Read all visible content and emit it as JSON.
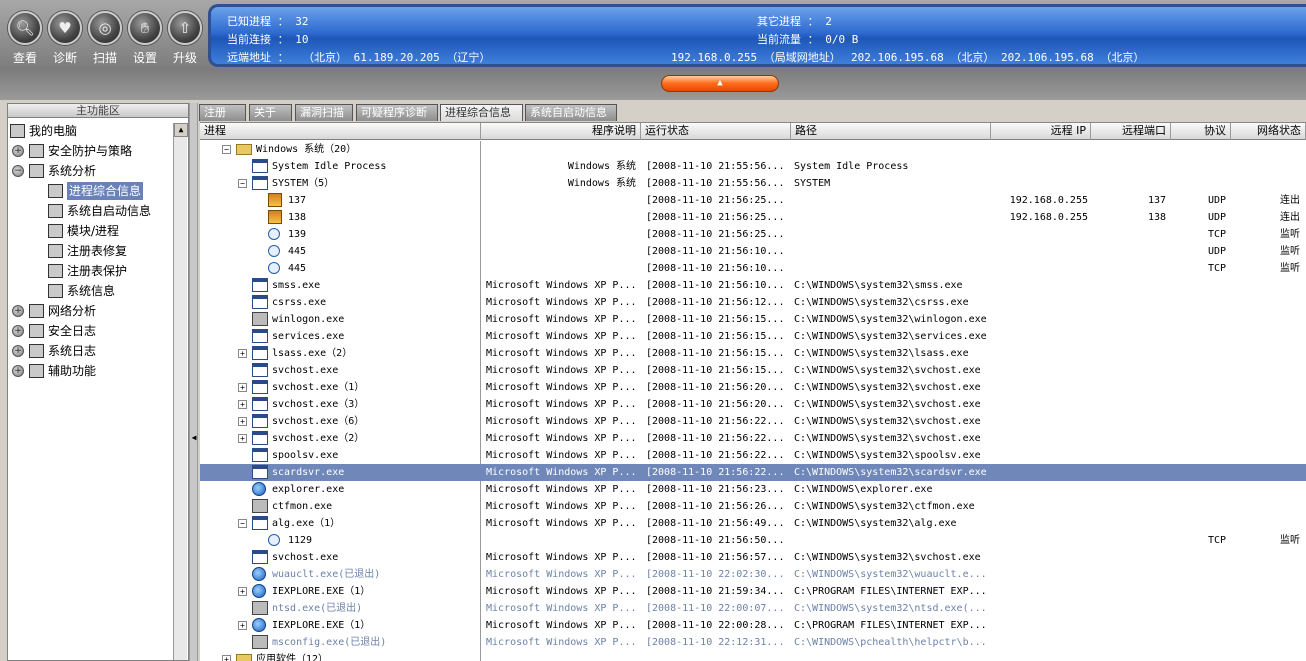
{
  "toolbar": {
    "buttons": [
      {
        "label": "查看",
        "icon": "magnifier-icon"
      },
      {
        "label": "诊断",
        "icon": "heart-icon"
      },
      {
        "label": "扫描",
        "icon": "scan-icon"
      },
      {
        "label": "设置",
        "icon": "hand-icon"
      },
      {
        "label": "升级",
        "icon": "upgrade-icon"
      }
    ]
  },
  "info": {
    "known_proc": "已知进程 ： 32",
    "other_proc": "其它进程 ： 2",
    "conn": "当前连接 ： 10",
    "traffic": "当前流量 ： 0/0 B",
    "remote_label": "远端地址 ：",
    "remote1": "（北京）   61.189.20.205 （辽宁）",
    "remote2": "192.168.0.255 （局域网地址）",
    "remote3": "202.106.195.68 （北京）",
    "remote4": "202.106.195.68 （北京）"
  },
  "sidebar": {
    "header": "主功能区",
    "items": [
      {
        "label": "我的电脑",
        "icon": "computer-icon"
      },
      {
        "label": "安全防护与策略",
        "icon": "policy-icon"
      },
      {
        "label": "系统分析",
        "icon": "system-icon"
      },
      {
        "label": "进程综合信息",
        "icon": "process-info-icon"
      },
      {
        "label": "系统自启动信息",
        "icon": "startup-icon"
      },
      {
        "label": "模块/进程",
        "icon": "module-icon"
      },
      {
        "label": "注册表修复",
        "icon": "registry-repair-icon"
      },
      {
        "label": "注册表保护",
        "icon": "registry-protect-icon"
      },
      {
        "label": "系统信息",
        "icon": "sysinfo-icon"
      },
      {
        "label": "网络分析",
        "icon": "network-icon"
      },
      {
        "label": "安全日志",
        "icon": "security-log-icon"
      },
      {
        "label": "系统日志",
        "icon": "system-log-icon"
      },
      {
        "label": "辅助功能",
        "icon": "helper-icon"
      }
    ]
  },
  "tabs": [
    "注册",
    "关于",
    "漏洞扫描",
    "可疑程序诊断",
    "进程综合信息",
    "系统自启动信息"
  ],
  "active_tab": "进程综合信息",
  "columns": [
    "进程",
    "程序说明",
    "运行状态",
    "路径",
    "远程 IP",
    "远程端口",
    "协议",
    "网络状态"
  ],
  "rows": [
    {
      "name": "Windows 系统（20）",
      "desc": "",
      "state": "",
      "path": "",
      "ip": "",
      "port": "",
      "proto": "",
      "net": ""
    },
    {
      "name": "System Idle Process",
      "desc": "Windows 系统",
      "state": "[2008-11-10 21:55:56...",
      "path": "System Idle Process",
      "ip": "",
      "port": "",
      "proto": "",
      "net": ""
    },
    {
      "name": "SYSTEM（5）",
      "desc": "Windows 系统",
      "state": "[2008-11-10 21:55:56...",
      "path": "SYSTEM",
      "ip": "",
      "port": "",
      "proto": "",
      "net": ""
    },
    {
      "name": "137",
      "desc": "",
      "state": "[2008-11-10 21:56:25...",
      "path": "",
      "ip": "192.168.0.255",
      "port": "137",
      "proto": "UDP",
      "net": "连出"
    },
    {
      "name": "138",
      "desc": "",
      "state": "[2008-11-10 21:56:25...",
      "path": "",
      "ip": "192.168.0.255",
      "port": "138",
      "proto": "UDP",
      "net": "连出"
    },
    {
      "name": "139",
      "desc": "",
      "state": "[2008-11-10 21:56:25...",
      "path": "",
      "ip": "",
      "port": "",
      "proto": "TCP",
      "net": "监听"
    },
    {
      "name": "445",
      "desc": "",
      "state": "[2008-11-10 21:56:10...",
      "path": "",
      "ip": "",
      "port": "",
      "proto": "UDP",
      "net": "监听"
    },
    {
      "name": "445",
      "desc": "",
      "state": "[2008-11-10 21:56:10...",
      "path": "",
      "ip": "",
      "port": "",
      "proto": "TCP",
      "net": "监听"
    },
    {
      "name": "smss.exe",
      "desc": "Microsoft Windows XP P...",
      "state": "[2008-11-10 21:56:10...",
      "path": "C:\\WINDOWS\\system32\\smss.exe",
      "ip": "",
      "port": "",
      "proto": "",
      "net": ""
    },
    {
      "name": "csrss.exe",
      "desc": "Microsoft Windows XP P...",
      "state": "[2008-11-10 21:56:12...",
      "path": "C:\\WINDOWS\\system32\\csrss.exe",
      "ip": "",
      "port": "",
      "proto": "",
      "net": ""
    },
    {
      "name": "winlogon.exe",
      "desc": "Microsoft Windows XP P...",
      "state": "[2008-11-10 21:56:15...",
      "path": "C:\\WINDOWS\\system32\\winlogon.exe",
      "ip": "",
      "port": "",
      "proto": "",
      "net": ""
    },
    {
      "name": "services.exe",
      "desc": "Microsoft Windows XP P...",
      "state": "[2008-11-10 21:56:15...",
      "path": "C:\\WINDOWS\\system32\\services.exe",
      "ip": "",
      "port": "",
      "proto": "",
      "net": ""
    },
    {
      "name": "lsass.exe（2）",
      "desc": "Microsoft Windows XP P...",
      "state": "[2008-11-10 21:56:15...",
      "path": "C:\\WINDOWS\\system32\\lsass.exe",
      "ip": "",
      "port": "",
      "proto": "",
      "net": ""
    },
    {
      "name": "svchost.exe",
      "desc": "Microsoft Windows XP P...",
      "state": "[2008-11-10 21:56:15...",
      "path": "C:\\WINDOWS\\system32\\svchost.exe",
      "ip": "",
      "port": "",
      "proto": "",
      "net": ""
    },
    {
      "name": "svchost.exe（1）",
      "desc": "Microsoft Windows XP P...",
      "state": "[2008-11-10 21:56:20...",
      "path": "C:\\WINDOWS\\system32\\svchost.exe",
      "ip": "",
      "port": "",
      "proto": "",
      "net": ""
    },
    {
      "name": "svchost.exe（3）",
      "desc": "Microsoft Windows XP P...",
      "state": "[2008-11-10 21:56:20...",
      "path": "C:\\WINDOWS\\system32\\svchost.exe",
      "ip": "",
      "port": "",
      "proto": "",
      "net": ""
    },
    {
      "name": "svchost.exe（6）",
      "desc": "Microsoft Windows XP P...",
      "state": "[2008-11-10 21:56:22...",
      "path": "C:\\WINDOWS\\system32\\svchost.exe",
      "ip": "",
      "port": "",
      "proto": "",
      "net": ""
    },
    {
      "name": "svchost.exe（2）",
      "desc": "Microsoft Windows XP P...",
      "state": "[2008-11-10 21:56:22...",
      "path": "C:\\WINDOWS\\system32\\svchost.exe",
      "ip": "",
      "port": "",
      "proto": "",
      "net": ""
    },
    {
      "name": "spoolsv.exe",
      "desc": "Microsoft Windows XP P...",
      "state": "[2008-11-10 21:56:22...",
      "path": "C:\\WINDOWS\\system32\\spoolsv.exe",
      "ip": "",
      "port": "",
      "proto": "",
      "net": ""
    },
    {
      "name": "scardsvr.exe",
      "desc": "Microsoft Windows XP P...",
      "state": "[2008-11-10 21:56:22...",
      "path": "C:\\WINDOWS\\system32\\scardsvr.exe",
      "ip": "",
      "port": "",
      "proto": "",
      "net": ""
    },
    {
      "name": "explorer.exe",
      "desc": "Microsoft Windows XP P...",
      "state": "[2008-11-10 21:56:23...",
      "path": "C:\\WINDOWS\\explorer.exe",
      "ip": "",
      "port": "",
      "proto": "",
      "net": ""
    },
    {
      "name": "ctfmon.exe",
      "desc": "Microsoft Windows XP P...",
      "state": "[2008-11-10 21:56:26...",
      "path": "C:\\WINDOWS\\system32\\ctfmon.exe",
      "ip": "",
      "port": "",
      "proto": "",
      "net": ""
    },
    {
      "name": "alg.exe（1）",
      "desc": "Microsoft Windows XP P...",
      "state": "[2008-11-10 21:56:49...",
      "path": "C:\\WINDOWS\\system32\\alg.exe",
      "ip": "",
      "port": "",
      "proto": "",
      "net": ""
    },
    {
      "name": "1129",
      "desc": "",
      "state": "[2008-11-10 21:56:50...",
      "path": "",
      "ip": "",
      "port": "",
      "proto": "TCP",
      "net": "监听"
    },
    {
      "name": "svchost.exe",
      "desc": "Microsoft Windows XP P...",
      "state": "[2008-11-10 21:56:57...",
      "path": "C:\\WINDOWS\\system32\\svchost.exe",
      "ip": "",
      "port": "",
      "proto": "",
      "net": ""
    },
    {
      "name": "wuauclt.exe(已退出)",
      "desc": "Microsoft Windows XP P...",
      "state": "[2008-11-10 22:02:30...",
      "path": "C:\\WINDOWS\\system32\\wuauclt.e...",
      "ip": "",
      "port": "",
      "proto": "",
      "net": ""
    },
    {
      "name": "IEXPLORE.EXE（1）",
      "desc": "Microsoft Windows XP P...",
      "state": "[2008-11-10 21:59:34...",
      "path": "C:\\PROGRAM FILES\\INTERNET EXP...",
      "ip": "",
      "port": "",
      "proto": "",
      "net": ""
    },
    {
      "name": "ntsd.exe(已退出)",
      "desc": "Microsoft Windows XP P...",
      "state": "[2008-11-10 22:00:07...",
      "path": "C:\\WINDOWS\\system32\\ntsd.exe(...",
      "ip": "",
      "port": "",
      "proto": "",
      "net": ""
    },
    {
      "name": "IEXPLORE.EXE（1）",
      "desc": "Microsoft Windows XP P...",
      "state": "[2008-11-10 22:00:28...",
      "path": "C:\\PROGRAM FILES\\INTERNET EXP...",
      "ip": "",
      "port": "",
      "proto": "",
      "net": ""
    },
    {
      "name": "msconfig.exe(已退出)",
      "desc": "Microsoft Windows XP P...",
      "state": "[2008-11-10 22:12:31...",
      "path": "C:\\WINDOWS\\pchealth\\helpctr\\b...",
      "ip": "",
      "port": "",
      "proto": "",
      "net": ""
    },
    {
      "name": "应用软件（12）",
      "desc": "",
      "state": "",
      "path": "",
      "ip": "",
      "port": "",
      "proto": "",
      "net": ""
    }
  ]
}
